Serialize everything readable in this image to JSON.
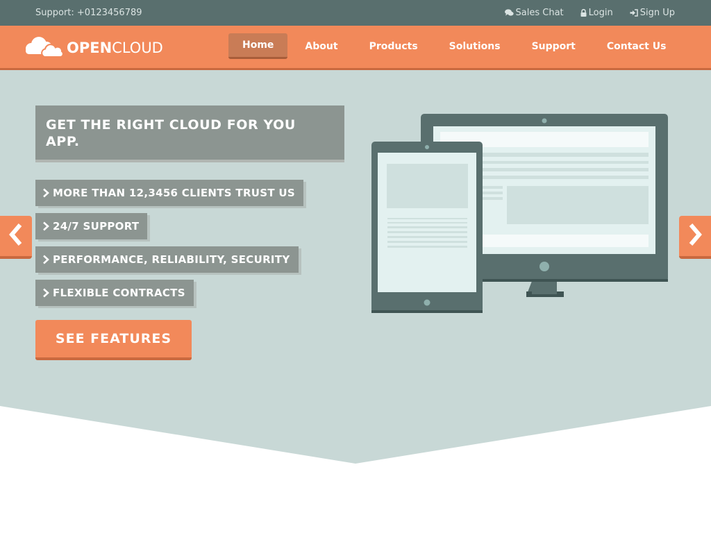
{
  "topbar": {
    "support": "Support: +0123456789",
    "links": [
      {
        "label": "Sales Chat",
        "icon": "chat-icon"
      },
      {
        "label": "Login",
        "icon": "lock-icon"
      },
      {
        "label": "Sign Up",
        "icon": "sign-in-icon"
      }
    ]
  },
  "brand": {
    "name_bold": "OPEN",
    "name_light": "CLOUD",
    "icon": "cloud-icon"
  },
  "nav": {
    "items": [
      {
        "label": "Home",
        "active": true
      },
      {
        "label": "About"
      },
      {
        "label": "Products"
      },
      {
        "label": "Solutions"
      },
      {
        "label": "Support"
      },
      {
        "label": "Contact Us"
      }
    ]
  },
  "hero": {
    "headline": "GET THE RIGHT CLOUD FOR YOU APP.",
    "features": [
      "MORE THAN 12,3456 CLIENTS TRUST US",
      "24/7 SUPPORT",
      "PERFORMANCE, RELIABILITY, SECURITY",
      "FLEXIBLE CONTRACTS"
    ],
    "cta": "SEE FEATURES",
    "prev_icon": "chevron-left-icon",
    "next_icon": "chevron-right-icon",
    "illustration_icons": [
      "desktop-monitor-icon",
      "tablet-icon"
    ]
  },
  "colors": {
    "topbar": "#596f6e",
    "accent": "#f2895a",
    "accent_dark": "#c9693f",
    "hero_bg": "#c8d8d6",
    "panel": "#8c9591"
  }
}
